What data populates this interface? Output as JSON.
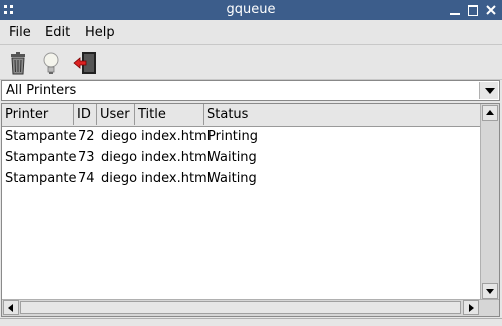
{
  "window": {
    "title": "gqueue"
  },
  "menu": {
    "file": "File",
    "edit": "Edit",
    "help": "Help"
  },
  "toolbar": {
    "delete_icon": "trash-icon",
    "info_icon": "lightbulb-icon",
    "exit_icon": "exit-door-icon"
  },
  "filter": {
    "selected": "All Printers"
  },
  "table": {
    "headers": {
      "printer": "Printer",
      "id": "ID",
      "user": "User",
      "title": "Title",
      "status": "Status"
    },
    "rows": [
      {
        "printer": "Stampante",
        "id": "72",
        "user": "diego",
        "title": "index.html",
        "status": "Printing"
      },
      {
        "printer": "Stampante",
        "id": "73",
        "user": "diego",
        "title": "index.html",
        "status": "Waiting"
      },
      {
        "printer": "Stampante",
        "id": "74",
        "user": "diego",
        "title": "index.html",
        "status": "Waiting"
      }
    ]
  },
  "colors": {
    "titlebar": "#3c5d8b",
    "window_bg": "#e6e6e6"
  }
}
